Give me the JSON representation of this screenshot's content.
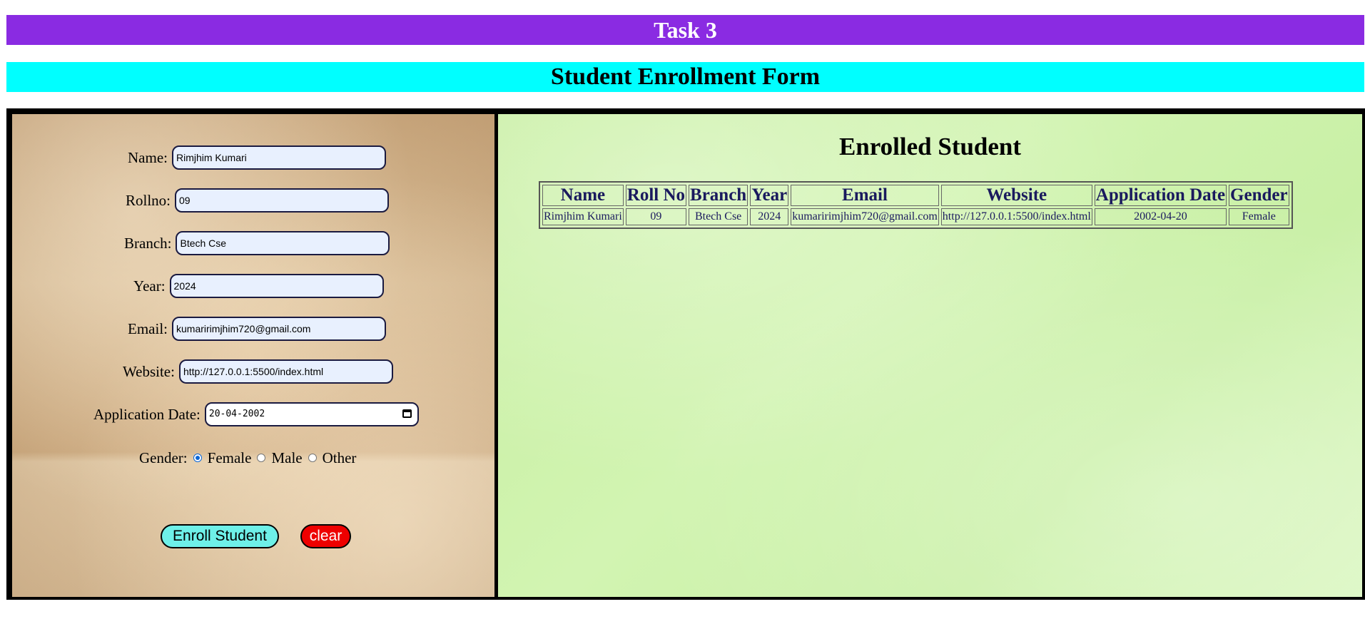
{
  "header": {
    "task_title": "Task 3",
    "form_title": "Student Enrollment Form"
  },
  "form": {
    "name": {
      "label": "Name:",
      "value": "Rimjhim Kumari"
    },
    "rollno": {
      "label": "Rollno:",
      "value": "09"
    },
    "branch": {
      "label": "Branch:",
      "value": "Btech Cse"
    },
    "year": {
      "label": "Year:",
      "value": "2024"
    },
    "email": {
      "label": "Email:",
      "value": "kumaririmjhim720@gmail.com"
    },
    "website": {
      "label": "Website:",
      "value": "http://127.0.0.1:5500/index.html"
    },
    "application_date": {
      "label": "Application Date:",
      "value": "20-04-2002"
    },
    "gender": {
      "label": "Gender:",
      "options": [
        "Female",
        "Male",
        "Other"
      ],
      "selected": "Female"
    },
    "enroll_label": "Enroll Student",
    "clear_label": "clear"
  },
  "table": {
    "title": "Enrolled Student",
    "headers": [
      "Name",
      "Roll No",
      "Branch",
      "Year",
      "Email",
      "Website",
      "Application Date",
      "Gender"
    ],
    "rows": [
      [
        "Rimjhim Kumari",
        "09",
        "Btech Cse",
        "2024",
        "kumaririmjhim720@gmail.com",
        "http://127.0.0.1:5500/index.html",
        "2002-04-20",
        "Female"
      ]
    ]
  },
  "colors": {
    "task_bar": "#8a2be2",
    "title_bar": "#00ffff",
    "enroll_button": "#6ef0e8",
    "clear_button": "#ee0000",
    "radio_checked": "#0b66d6"
  }
}
